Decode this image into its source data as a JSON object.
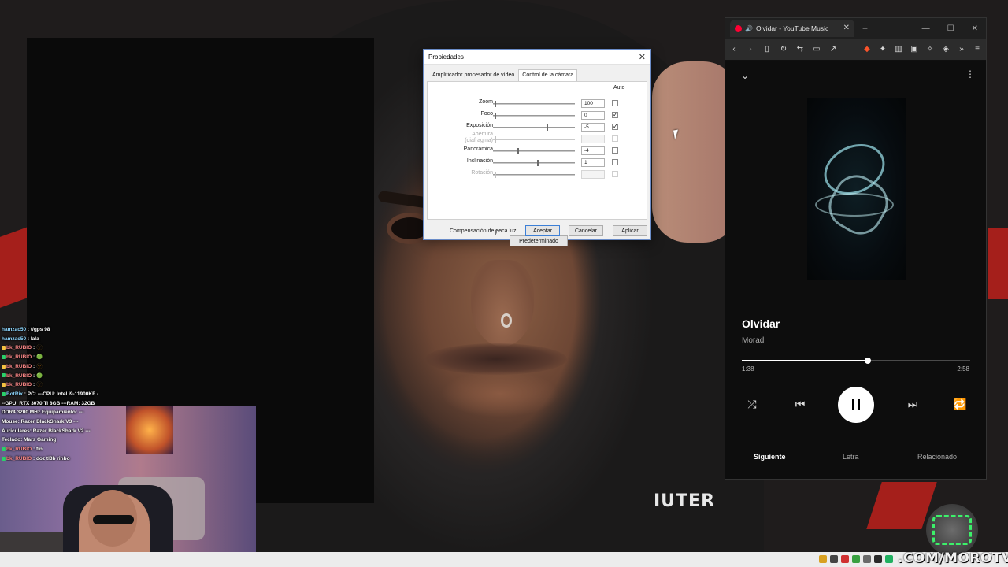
{
  "background": {
    "brand_text": "IUTER"
  },
  "chat": [
    {
      "user": "hamzac50",
      "text": "t/gps 98",
      "badge": "none"
    },
    {
      "user": "hamzac50",
      "text": "lala",
      "badge": "none"
    },
    {
      "user": "bk_RUBIO",
      "text": "🫥",
      "badge": "yellow"
    },
    {
      "user": "bk_RUBIO",
      "text": "🟢",
      "badge": "green"
    },
    {
      "user": "bk_RUBIO",
      "text": "🫥",
      "badge": "yellow"
    },
    {
      "user": "bk_RUBIO",
      "text": "🟢",
      "badge": "green"
    },
    {
      "user": "bk_RUBIO",
      "text": "🫥",
      "badge": "yellow"
    },
    {
      "user": "BotRix",
      "text": "PC: ---CPU: Intel i9-11900KF ---GPU: RTX 3070 Ti 8GB ---RAM: 32GB DDR4 3200 MHz Equipamiento: ---Mouse: Razer BlackShark V3 ---Auriculares: Razer BlackShark V2 ---Teclado: Mars Gaming",
      "badge": "bot"
    },
    {
      "user": "bk_RUBIO",
      "text": "fin",
      "badge": "green"
    },
    {
      "user": "bk_RUBIO",
      "text": "doz tl3b rinbo",
      "badge": "green"
    }
  ],
  "dialog": {
    "title": "Propiedades",
    "close_label": "✕",
    "tabs": [
      {
        "label": "Amplificador procesador de vídeo",
        "active": false
      },
      {
        "label": "Control de la cámara",
        "active": true
      }
    ],
    "auto_header": "Auto",
    "rows": [
      {
        "label": "Zoom",
        "value": "100",
        "auto": false,
        "disabled": false,
        "slider_pos": 0.02
      },
      {
        "label": "Foco",
        "value": "0",
        "auto": true,
        "disabled": false,
        "slider_pos": 0.02
      },
      {
        "label": "Exposición",
        "value": "-5",
        "auto": true,
        "disabled": false,
        "slider_pos": 0.67
      },
      {
        "label": "Abertura (diafragma)",
        "value": "",
        "auto": false,
        "disabled": true,
        "slider_pos": 0.02
      },
      {
        "label": "Panorámica",
        "value": "-4",
        "auto": false,
        "disabled": false,
        "slider_pos": 0.3
      },
      {
        "label": "Inclinación",
        "value": "1",
        "auto": false,
        "disabled": false,
        "slider_pos": 0.55
      },
      {
        "label": "Rotación",
        "value": "",
        "auto": false,
        "disabled": true,
        "slider_pos": 0.02
      }
    ],
    "low_light_label": "Compensación de poca luz",
    "default_button": "Predeterminado",
    "ok_button": "Aceptar",
    "cancel_button": "Cancelar",
    "apply_button": "Aplicar"
  },
  "browser": {
    "tab_title": "Olvidar - YouTube Music",
    "new_tab": "+",
    "win_min": "—",
    "win_max": "☐",
    "win_close": "✕"
  },
  "ytmusic": {
    "song_title": "Olvidar",
    "artist": "Morad",
    "current_time": "1:38",
    "total_time": "2:58",
    "progress": 0.55,
    "tabs": [
      {
        "label": "Siguiente",
        "active": true
      },
      {
        "label": "Letra",
        "active": false
      },
      {
        "label": "Relacionado",
        "active": false
      }
    ]
  },
  "watermark": ".COM/MOROTVV"
}
